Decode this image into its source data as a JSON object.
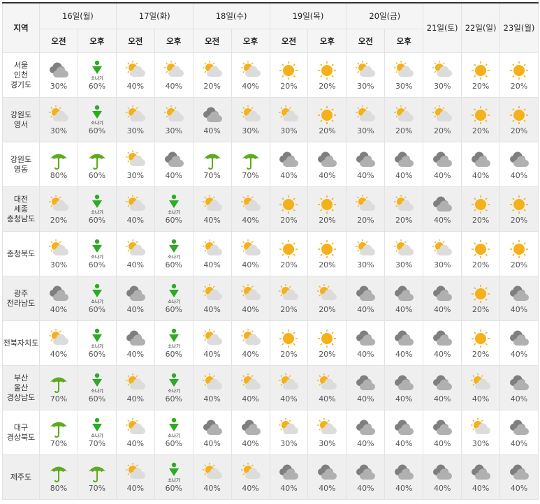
{
  "header": {
    "region_label": "지역",
    "days": [
      "16일(월)",
      "17일(화)",
      "18일(수)",
      "19일(목)",
      "20일(금)",
      "21일(토)",
      "22일(일)",
      "23일(월)"
    ],
    "am": "오전",
    "pm": "오후",
    "shower_label": "소나기"
  },
  "rows": [
    {
      "region": [
        "서울",
        "인천",
        "경기도"
      ],
      "cells": [
        {
          "icon": "cloudy",
          "pct": "30%"
        },
        {
          "icon": "shower",
          "pct": "60%"
        },
        {
          "icon": "partly-cloudy",
          "pct": "40%"
        },
        {
          "icon": "partly-cloudy",
          "pct": "40%"
        },
        {
          "icon": "partly-cloudy",
          "pct": "20%"
        },
        {
          "icon": "partly-cloudy",
          "pct": "40%"
        },
        {
          "icon": "sunny",
          "pct": "20%"
        },
        {
          "icon": "sunny",
          "pct": "20%"
        },
        {
          "icon": "partly-cloudy",
          "pct": "30%"
        },
        {
          "icon": "partly-cloudy",
          "pct": "30%"
        },
        {
          "icon": "partly-cloudy",
          "pct": "30%"
        },
        {
          "icon": "sunny",
          "pct": "20%"
        },
        {
          "icon": "sunny",
          "pct": "20%"
        }
      ]
    },
    {
      "region": [
        "강원도",
        "영서"
      ],
      "cells": [
        {
          "icon": "partly-cloudy",
          "pct": "30%"
        },
        {
          "icon": "shower",
          "pct": "60%"
        },
        {
          "icon": "partly-cloudy",
          "pct": "30%"
        },
        {
          "icon": "partly-cloudy",
          "pct": "30%"
        },
        {
          "icon": "cloudy",
          "pct": "40%"
        },
        {
          "icon": "partly-cloudy",
          "pct": "30%"
        },
        {
          "icon": "partly-cloudy",
          "pct": "30%"
        },
        {
          "icon": "sunny",
          "pct": "20%"
        },
        {
          "icon": "partly-cloudy",
          "pct": "30%"
        },
        {
          "icon": "partly-cloudy",
          "pct": "20%"
        },
        {
          "icon": "partly-cloudy",
          "pct": "20%"
        },
        {
          "icon": "sunny",
          "pct": "20%"
        },
        {
          "icon": "sunny",
          "pct": "20%"
        }
      ]
    },
    {
      "region": [
        "강원도",
        "영동"
      ],
      "cells": [
        {
          "icon": "rain",
          "pct": "80%"
        },
        {
          "icon": "rain",
          "pct": "60%"
        },
        {
          "icon": "partly-cloudy",
          "pct": "30%"
        },
        {
          "icon": "cloudy",
          "pct": "40%"
        },
        {
          "icon": "rain",
          "pct": "70%"
        },
        {
          "icon": "rain",
          "pct": "70%"
        },
        {
          "icon": "cloudy",
          "pct": "40%"
        },
        {
          "icon": "cloudy",
          "pct": "40%"
        },
        {
          "icon": "cloudy",
          "pct": "40%"
        },
        {
          "icon": "cloudy",
          "pct": "40%"
        },
        {
          "icon": "cloudy",
          "pct": "40%"
        },
        {
          "icon": "cloudy",
          "pct": "40%"
        },
        {
          "icon": "cloudy",
          "pct": "40%"
        }
      ]
    },
    {
      "region": [
        "대전",
        "세종",
        "충청남도"
      ],
      "cells": [
        {
          "icon": "partly-cloudy",
          "pct": "20%"
        },
        {
          "icon": "shower",
          "pct": "60%"
        },
        {
          "icon": "partly-cloudy",
          "pct": "40%"
        },
        {
          "icon": "shower",
          "pct": "60%"
        },
        {
          "icon": "partly-cloudy",
          "pct": "40%"
        },
        {
          "icon": "partly-cloudy",
          "pct": "40%"
        },
        {
          "icon": "sunny",
          "pct": "20%"
        },
        {
          "icon": "sunny",
          "pct": "20%"
        },
        {
          "icon": "partly-cloudy",
          "pct": "20%"
        },
        {
          "icon": "partly-cloudy",
          "pct": "20%"
        },
        {
          "icon": "cloudy",
          "pct": "40%"
        },
        {
          "icon": "sunny",
          "pct": "20%"
        },
        {
          "icon": "sunny",
          "pct": "20%"
        }
      ]
    },
    {
      "region": [
        "충청북도"
      ],
      "cells": [
        {
          "icon": "partly-cloudy",
          "pct": "30%"
        },
        {
          "icon": "shower",
          "pct": "60%"
        },
        {
          "icon": "partly-cloudy",
          "pct": "40%"
        },
        {
          "icon": "shower",
          "pct": "60%"
        },
        {
          "icon": "partly-cloudy",
          "pct": "40%"
        },
        {
          "icon": "partly-cloudy",
          "pct": "40%"
        },
        {
          "icon": "sunny",
          "pct": "20%"
        },
        {
          "icon": "sunny",
          "pct": "20%"
        },
        {
          "icon": "partly-cloudy",
          "pct": "30%"
        },
        {
          "icon": "partly-cloudy",
          "pct": "30%"
        },
        {
          "icon": "partly-cloudy",
          "pct": "30%"
        },
        {
          "icon": "sunny",
          "pct": "20%"
        },
        {
          "icon": "sunny",
          "pct": "20%"
        }
      ]
    },
    {
      "region": [
        "광주",
        "전라남도"
      ],
      "cells": [
        {
          "icon": "cloudy",
          "pct": "40%"
        },
        {
          "icon": "shower",
          "pct": "60%"
        },
        {
          "icon": "cloudy",
          "pct": "40%"
        },
        {
          "icon": "shower",
          "pct": "60%"
        },
        {
          "icon": "partly-cloudy",
          "pct": "40%"
        },
        {
          "icon": "partly-cloudy",
          "pct": "40%"
        },
        {
          "icon": "partly-cloudy",
          "pct": "20%"
        },
        {
          "icon": "partly-cloudy",
          "pct": "20%"
        },
        {
          "icon": "cloudy",
          "pct": "40%"
        },
        {
          "icon": "cloudy",
          "pct": "40%"
        },
        {
          "icon": "cloudy",
          "pct": "40%"
        },
        {
          "icon": "sunny",
          "pct": "20%"
        },
        {
          "icon": "cloudy",
          "pct": "40%"
        }
      ]
    },
    {
      "region": [
        "전북자치도"
      ],
      "cells": [
        {
          "icon": "partly-cloudy",
          "pct": "40%"
        },
        {
          "icon": "shower",
          "pct": "60%"
        },
        {
          "icon": "cloudy",
          "pct": "40%"
        },
        {
          "icon": "shower",
          "pct": "60%"
        },
        {
          "icon": "partly-cloudy",
          "pct": "40%"
        },
        {
          "icon": "partly-cloudy",
          "pct": "40%"
        },
        {
          "icon": "sunny",
          "pct": "20%"
        },
        {
          "icon": "sunny",
          "pct": "20%"
        },
        {
          "icon": "cloudy",
          "pct": "40%"
        },
        {
          "icon": "cloudy",
          "pct": "40%"
        },
        {
          "icon": "cloudy",
          "pct": "40%"
        },
        {
          "icon": "sunny",
          "pct": "20%"
        },
        {
          "icon": "cloudy",
          "pct": "40%"
        }
      ]
    },
    {
      "region": [
        "부산",
        "울산",
        "경상남도"
      ],
      "cells": [
        {
          "icon": "rain",
          "pct": "70%"
        },
        {
          "icon": "shower",
          "pct": "60%"
        },
        {
          "icon": "partly-cloudy",
          "pct": "40%"
        },
        {
          "icon": "shower",
          "pct": "60%"
        },
        {
          "icon": "partly-cloudy",
          "pct": "40%"
        },
        {
          "icon": "partly-cloudy",
          "pct": "40%"
        },
        {
          "icon": "partly-cloudy",
          "pct": "40%"
        },
        {
          "icon": "partly-cloudy",
          "pct": "40%"
        },
        {
          "icon": "cloudy",
          "pct": "40%"
        },
        {
          "icon": "cloudy",
          "pct": "40%"
        },
        {
          "icon": "cloudy",
          "pct": "40%"
        },
        {
          "icon": "partly-cloudy",
          "pct": "40%"
        },
        {
          "icon": "cloudy",
          "pct": "40%"
        }
      ]
    },
    {
      "region": [
        "대구",
        "경상북도"
      ],
      "cells": [
        {
          "icon": "rain",
          "pct": "70%"
        },
        {
          "icon": "shower",
          "pct": "70%"
        },
        {
          "icon": "partly-cloudy",
          "pct": "40%"
        },
        {
          "icon": "shower",
          "pct": "60%"
        },
        {
          "icon": "cloudy",
          "pct": "40%"
        },
        {
          "icon": "cloudy",
          "pct": "40%"
        },
        {
          "icon": "partly-cloudy",
          "pct": "30%"
        },
        {
          "icon": "partly-cloudy",
          "pct": "30%"
        },
        {
          "icon": "cloudy",
          "pct": "40%"
        },
        {
          "icon": "cloudy",
          "pct": "40%"
        },
        {
          "icon": "cloudy",
          "pct": "40%"
        },
        {
          "icon": "partly-cloudy",
          "pct": "30%"
        },
        {
          "icon": "cloudy",
          "pct": "40%"
        }
      ]
    },
    {
      "region": [
        "제주도"
      ],
      "cells": [
        {
          "icon": "rain",
          "pct": "80%"
        },
        {
          "icon": "rain",
          "pct": "70%"
        },
        {
          "icon": "partly-cloudy",
          "pct": "40%"
        },
        {
          "icon": "shower",
          "pct": "60%"
        },
        {
          "icon": "partly-cloudy",
          "pct": "40%"
        },
        {
          "icon": "partly-cloudy",
          "pct": "40%"
        },
        {
          "icon": "cloudy",
          "pct": "40%"
        },
        {
          "icon": "cloudy",
          "pct": "40%"
        },
        {
          "icon": "cloudy",
          "pct": "40%"
        },
        {
          "icon": "cloudy",
          "pct": "40%"
        },
        {
          "icon": "cloudy",
          "pct": "40%"
        },
        {
          "icon": "cloudy",
          "pct": "40%"
        },
        {
          "icon": "cloudy",
          "pct": "40%"
        }
      ]
    }
  ],
  "colors": {
    "sun": "#f5b01a",
    "cloud": "#9b9b9b",
    "rain": "#5eaa1e",
    "shower": "#2eaa24"
  }
}
